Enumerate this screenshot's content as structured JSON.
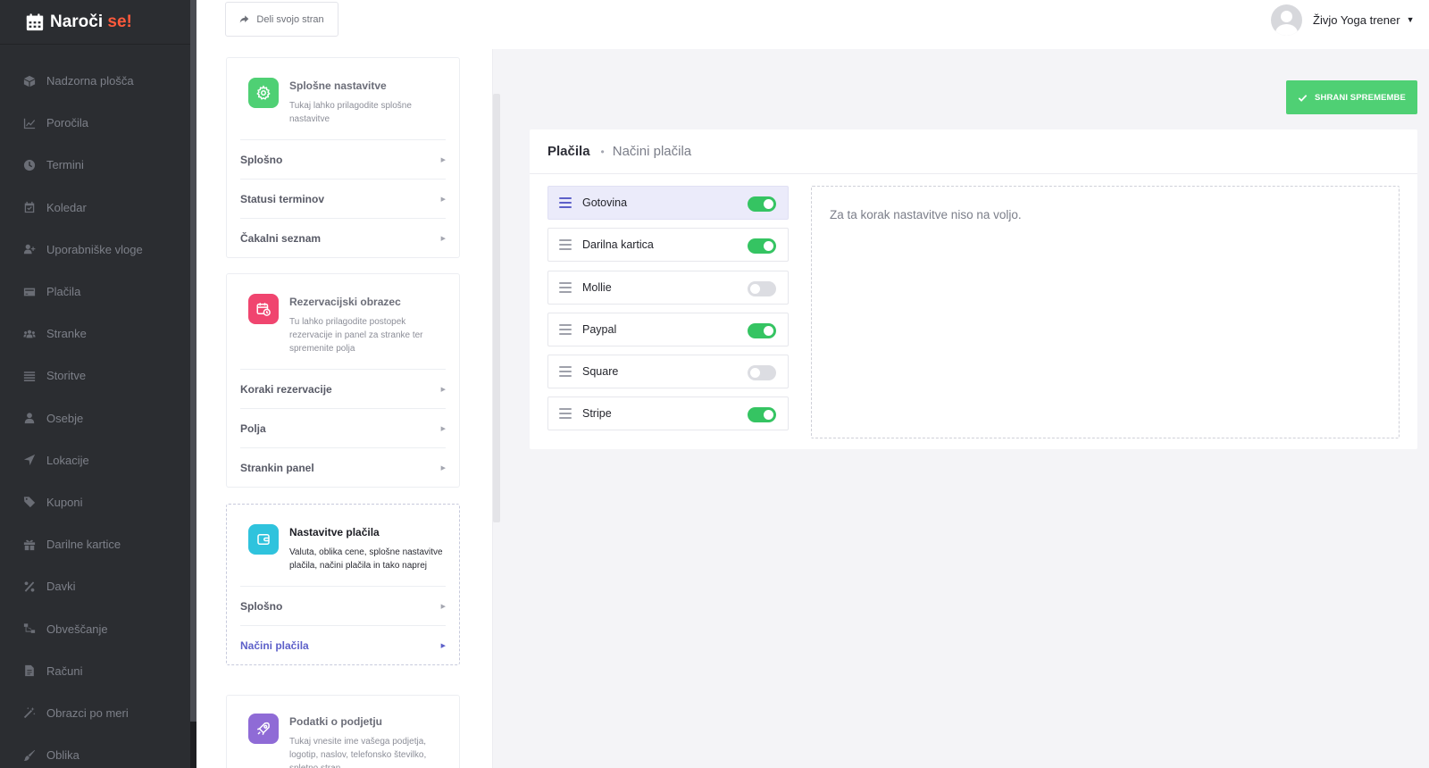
{
  "brand": {
    "name": "Naroči",
    "accent": "se!",
    "icon": "calendar-icon"
  },
  "sidebar": {
    "items": [
      {
        "label": "Nadzorna plošča",
        "icon": "cube-icon"
      },
      {
        "label": "Poročila",
        "icon": "chart-icon"
      },
      {
        "label": "Termini",
        "icon": "clock-icon"
      },
      {
        "label": "Koledar",
        "icon": "calendar-check-icon"
      },
      {
        "label": "Uporabniške vloge",
        "icon": "user-plus-icon"
      },
      {
        "label": "Plačila",
        "icon": "credit-card-icon"
      },
      {
        "label": "Stranke",
        "icon": "users-icon"
      },
      {
        "label": "Storitve",
        "icon": "list-icon"
      },
      {
        "label": "Osebje",
        "icon": "user-icon"
      },
      {
        "label": "Lokacije",
        "icon": "location-arrow-icon"
      },
      {
        "label": "Kuponi",
        "icon": "tag-icon"
      },
      {
        "label": "Darilne kartice",
        "icon": "gift-icon"
      },
      {
        "label": "Davki",
        "icon": "percent-icon"
      },
      {
        "label": "Obveščanje",
        "icon": "sitemap-icon"
      },
      {
        "label": "Računi",
        "icon": "file-icon"
      },
      {
        "label": "Obrazci po meri",
        "icon": "magic-icon"
      },
      {
        "label": "Oblika",
        "icon": "brush-icon"
      }
    ]
  },
  "topbar": {
    "share_label": "Deli svojo stran",
    "user_name": "Živjo Yoga trener"
  },
  "settings": {
    "cards": [
      {
        "title": "Splošne nastavitve",
        "desc": "Tukaj lahko prilagodite splošne nastavitve",
        "color": "#4fd074",
        "links": [
          "Splošno",
          "Statusi terminov",
          "Čakalni seznam"
        ]
      },
      {
        "title": "Rezervacijski obrazec",
        "desc": "Tu lahko prilagodite postopek rezervacije in panel za stranke ter spremenite polja",
        "color": "#f0456f",
        "links": [
          "Koraki rezervacije",
          "Polja",
          "Strankin panel"
        ]
      },
      {
        "title": "Nastavitve plačila",
        "desc": "Valuta, oblika cene, splošne nastavitve plačila, načini plačila in tako naprej",
        "color": "#2fc3dd",
        "links": [
          "Splošno",
          "Načini plačila"
        ]
      },
      {
        "title": "Podatki o podjetju",
        "desc": "Tukaj vnesite ime vašega podjetja, logotip, naslov, telefonsko številko, spletno stran",
        "color": "#8f6bd6",
        "links": []
      }
    ]
  },
  "save_label": "SHRANI SPREMEMBE",
  "panel": {
    "title": "Plačila",
    "separator": "•",
    "subtitle": "Načini plačila",
    "methods": [
      {
        "label": "Gotovina",
        "enabled": true
      },
      {
        "label": "Darilna kartica",
        "enabled": true
      },
      {
        "label": "Mollie",
        "enabled": false
      },
      {
        "label": "Paypal",
        "enabled": true
      },
      {
        "label": "Square",
        "enabled": false
      },
      {
        "label": "Stripe",
        "enabled": true
      }
    ],
    "empty_message": "Za ta korak nastavitve niso na voljo."
  },
  "colors": {
    "sidebar_bg": "#2b2d31",
    "accent": "#5d60c9",
    "brand_accent": "#ff5a3c",
    "save_green": "#4fd074",
    "toggle_on": "#35c462"
  }
}
